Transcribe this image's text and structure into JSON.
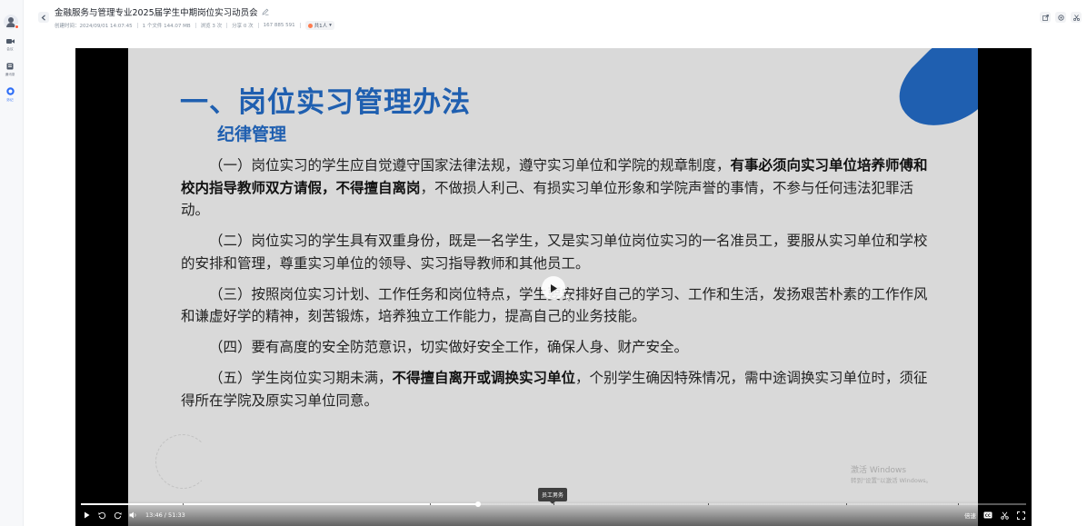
{
  "sidebar": {
    "items": [
      {
        "label": "会议",
        "icon": "video-camera-icon",
        "active": false
      },
      {
        "label": "通讯录",
        "icon": "contacts-icon",
        "active": false
      },
      {
        "label": "妙记",
        "icon": "minutes-icon",
        "active": true
      }
    ]
  },
  "header": {
    "title": "金融服务与管理专业2025届学生中期岗位实习动员会",
    "meta": {
      "created": "创建时间：2024/09/01 14:07:45",
      "files": "1 个文件 144.07 MB",
      "views": "浏览 3 次",
      "shares": "分享 0 次",
      "code": "167 885 591",
      "owner": "共1人"
    }
  },
  "slide": {
    "title": "一、岗位实习管理办法",
    "subtitle": "纪律管理",
    "p1_a": "（一）岗位实习的学生应自觉遵守国家法律法规，遵守实习单位和学院的规章制度，",
    "p1_b": "有事必须向实习单位培养师傅和校内指导教师双方请假，不得擅自离岗",
    "p1_c": "，不做损人利己、有损实习单位形象和学院声誉的事情，不参与任何违法犯罪活动。",
    "p2": "（二）岗位实习的学生具有双重身份，既是一名学生，又是实习单位岗位实习的一名准员工，要服从实习单位和学校的安排和管理，尊重实习单位的领导、实习指导教师和其他员工。",
    "p3": "（三）按照岗位实习计划、工作任务和岗位特点，学生要安排好自己的学习、工作和生活，发扬艰苦朴素的工作作风和谦虚好学的精神，刻苦锻炼，培养独立工作能力，提高自己的业务技能。",
    "p4": "（四）要有高度的安全防范意识，切实做好安全工作，确保人身、财产安全。",
    "p5_a": "（五）学生岗位实习期未满，",
    "p5_b": "不得擅自离开或调换实习单位",
    "p5_c": "，个别学生确因特殊情况，需中途调换实习单位时，须征得所在学院及原实习单位同意。",
    "watermark_line1": "激活 Windows",
    "watermark_line2": "转到\"设置\"以激活 Windows。",
    "accent_color": "#1f5fb0"
  },
  "player": {
    "tooltip": "员工男务",
    "progress": 0.42,
    "current_time": "13:46 / 51:33",
    "speed_label": "倍速",
    "cc_label": "CC"
  }
}
